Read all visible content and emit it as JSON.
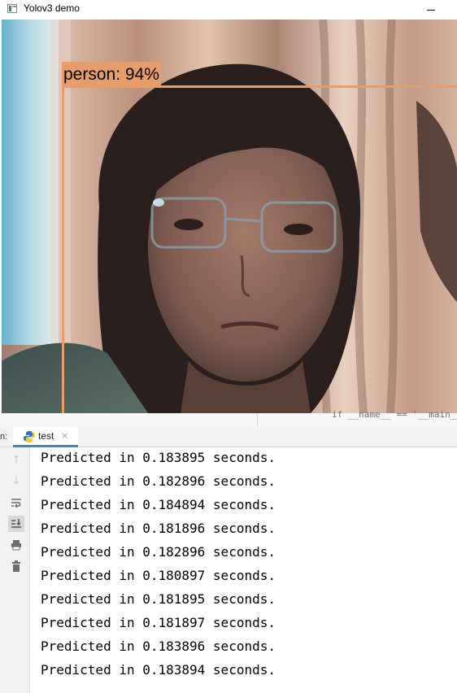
{
  "window": {
    "title": "Yolov3 demo"
  },
  "detection": {
    "label": "person: 94%",
    "box_color": "#e79c6c"
  },
  "editor": {
    "code_snippet": "if __name__ == '__main__'"
  },
  "run_panel": {
    "prefix": "n:",
    "tab_label": "test",
    "tab_close": "×",
    "toolbar_icons": [
      "arrow-up-icon",
      "arrow-down-icon",
      "soft-wrap-icon",
      "scroll-to-end-icon",
      "print-icon",
      "trash-icon"
    ]
  },
  "console": {
    "lines": [
      "Predicted in 0.183895 seconds.",
      "Predicted in 0.182896 seconds.",
      "Predicted in 0.184894 seconds.",
      "Predicted in 0.181896 seconds.",
      "Predicted in 0.182896 seconds.",
      "Predicted in 0.180897 seconds.",
      "Predicted in 0.181895 seconds.",
      "Predicted in 0.181897 seconds.",
      "Predicted in 0.183896 seconds.",
      "Predicted in 0.183894 seconds."
    ]
  }
}
